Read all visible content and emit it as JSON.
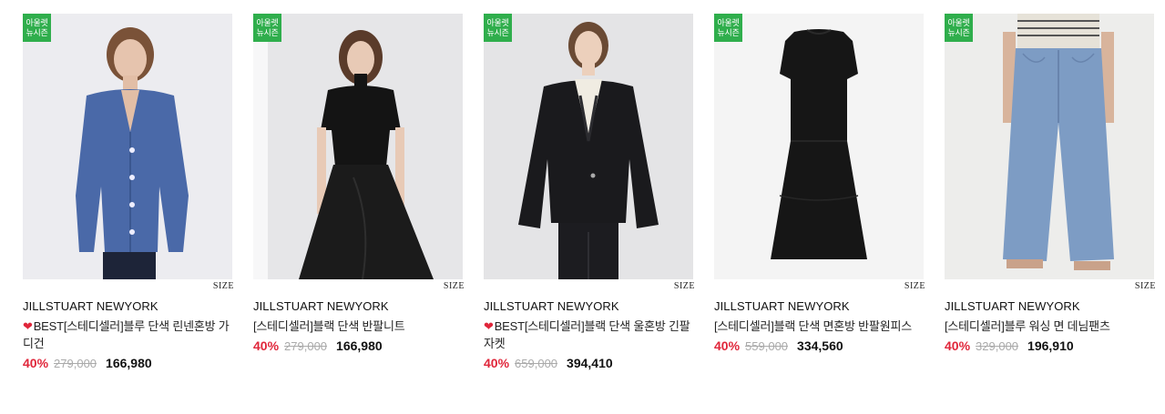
{
  "products": [
    {
      "badge": [
        "아울렛",
        "뉴시즌"
      ],
      "size_label": "SIZE",
      "brand": "JILLSTUART NEWYORK",
      "best": true,
      "name": "BEST[스테디셀러]블루 단색 린넨혼방 가디건",
      "discount": "40%",
      "original_price": "279,000",
      "final_price": "166,980",
      "image": "blue-cardigan-model",
      "colors": {
        "bg": "#ececf0",
        "garment": "#4a69a8"
      }
    },
    {
      "badge": [
        "아울렛",
        "뉴시즌"
      ],
      "size_label": "SIZE",
      "brand": "JILLSTUART NEWYORK",
      "best": false,
      "name": "[스테디셀러]블랙 단색 반팔니트",
      "discount": "40%",
      "original_price": "279,000",
      "final_price": "166,980",
      "image": "black-short-sleeve-knit-model",
      "colors": {
        "bg": "#e6e6e8",
        "garment": "#141414"
      }
    },
    {
      "badge": [
        "아울렛",
        "뉴시즌"
      ],
      "size_label": "SIZE",
      "brand": "JILLSTUART NEWYORK",
      "best": true,
      "name": "BEST[스테디셀러]블랙 단색 울혼방 긴팔자켓",
      "discount": "40%",
      "original_price": "659,000",
      "final_price": "394,410",
      "image": "black-wool-jacket-model",
      "colors": {
        "bg": "#e4e4e6",
        "garment": "#1a1a1d"
      }
    },
    {
      "badge": [
        "아울렛",
        "뉴시즌"
      ],
      "size_label": "SIZE",
      "brand": "JILLSTUART NEWYORK",
      "best": false,
      "name": "[스테디셀러]블랙 단색 면혼방 반팔원피스",
      "discount": "40%",
      "original_price": "559,000",
      "final_price": "334,560",
      "image": "black-cotton-dress",
      "colors": {
        "bg": "#f4f4f4",
        "garment": "#161616"
      }
    },
    {
      "badge": [
        "아울렛",
        "뉴시즌"
      ],
      "size_label": "SIZE",
      "brand": "JILLSTUART NEWYORK",
      "best": false,
      "name": "[스테디셀러]블루 워싱 면 데님팬츠",
      "discount": "40%",
      "original_price": "329,000",
      "final_price": "196,910",
      "image": "blue-washed-denim-pants-model",
      "colors": {
        "bg": "#ededeb",
        "garment": "#7d9cc4"
      }
    }
  ]
}
